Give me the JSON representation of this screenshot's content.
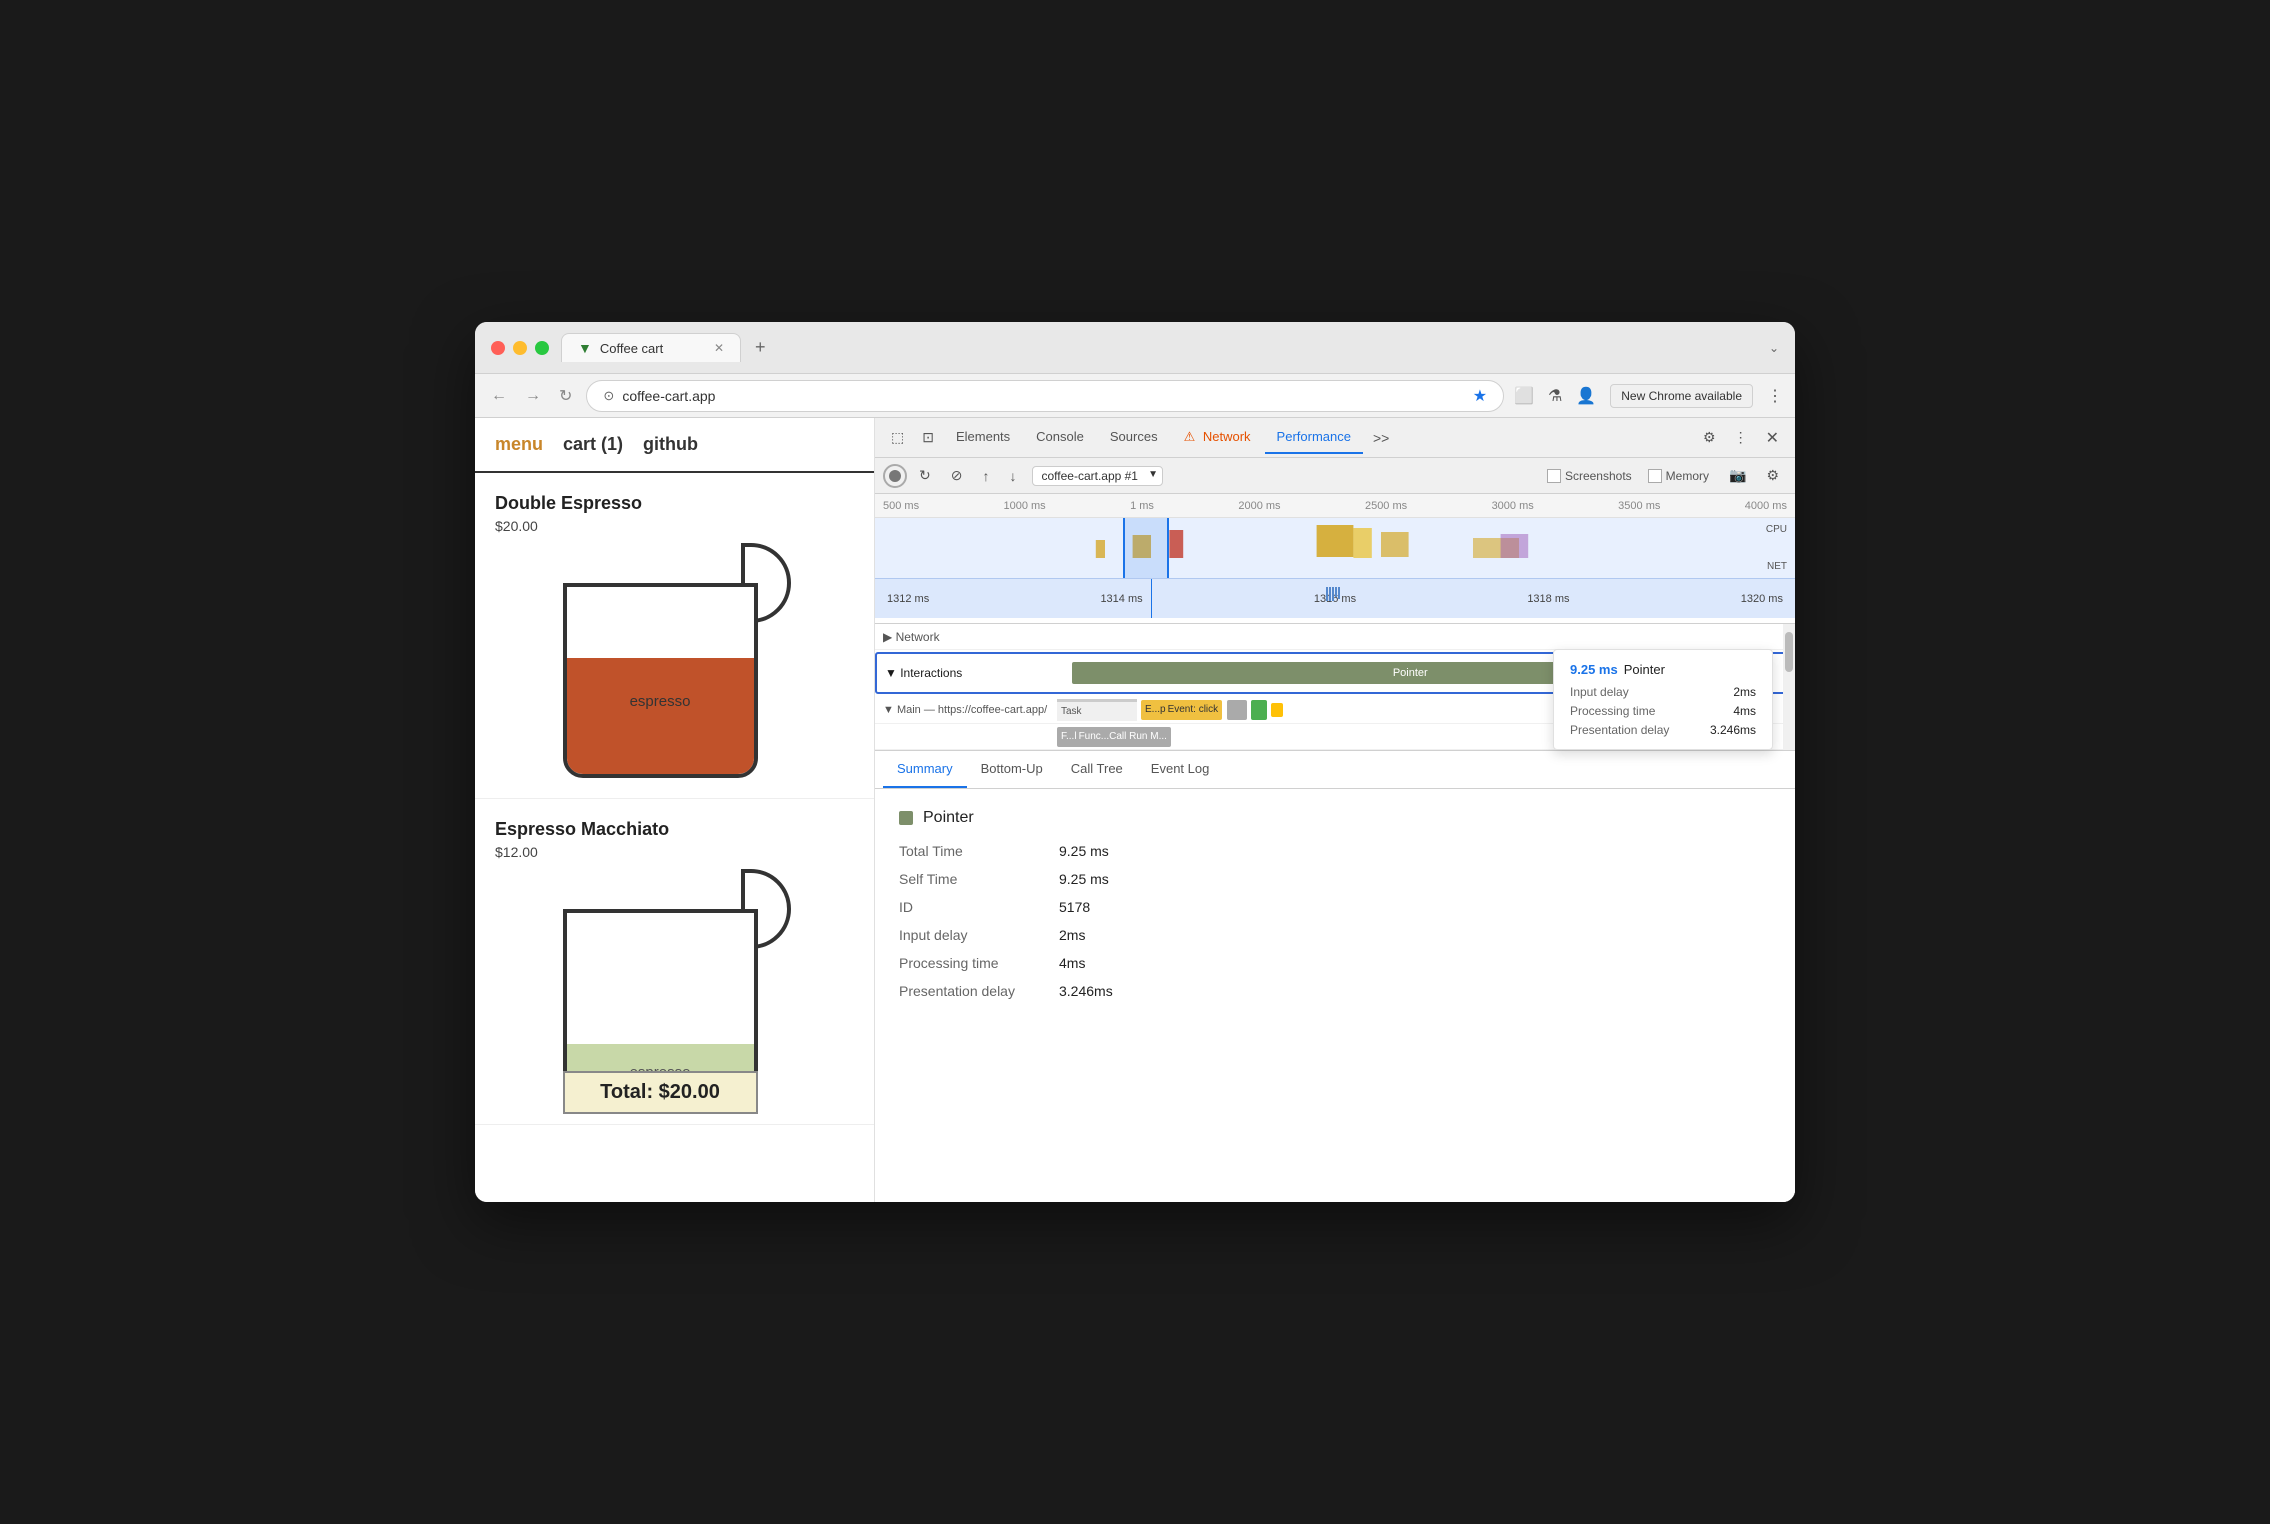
{
  "window": {
    "title": "Coffee cart"
  },
  "browser": {
    "url": "coffee-cart.app",
    "tab_title": "Coffee cart",
    "new_chrome_label": "New Chrome available"
  },
  "website": {
    "nav": {
      "menu": "menu",
      "cart": "cart (1)",
      "github": "github"
    },
    "products": [
      {
        "name": "Double Espresso",
        "price": "$20.00",
        "liquid_label": "espresso",
        "show_total": false
      },
      {
        "name": "Espresso Macchiato",
        "price": "$12.00",
        "liquid_label": "espresso",
        "show_total": true,
        "total": "Total: $20.00"
      }
    ]
  },
  "devtools": {
    "tabs": [
      "Elements",
      "Console",
      "Sources",
      "Network",
      "Performance"
    ],
    "active_tab": "Performance",
    "warning_tab": "Network",
    "target": "coffee-cart.app #1",
    "screenshots_label": "Screenshots",
    "memory_label": "Memory",
    "toolbar_buttons": [
      "record",
      "reload",
      "clear",
      "upload",
      "download"
    ],
    "timeline": {
      "ruler_marks": [
        "500 ms",
        "1000 ms",
        "1 ms",
        "2000 ms",
        "2500 ms",
        "3000 ms",
        "3500 ms",
        "4000 ms"
      ],
      "zoom_marks": [
        "1312 ms",
        "1314 ms",
        "1316 ms",
        "1318 ms",
        "1320 ms"
      ],
      "cpu_label": "CPU",
      "net_label": "NET"
    },
    "tracks": {
      "network_label": "▶ Network",
      "interactions_label": "▼ Interactions",
      "main_label": "▼ Main — https://coffee-cart.app/",
      "task_label": "Task",
      "event_label": "E...p",
      "event_text": "Event: click",
      "func_label": "F...l",
      "func_text": "Func...Call Run M..."
    },
    "tooltip": {
      "ms": "9.25 ms",
      "title": "Pointer",
      "input_delay_label": "Input delay",
      "input_delay_val": "2ms",
      "processing_time_label": "Processing time",
      "processing_time_val": "4ms",
      "presentation_delay_label": "Presentation delay",
      "presentation_delay_val": "3.246ms"
    },
    "summary": {
      "tabs": [
        "Summary",
        "Bottom-Up",
        "Call Tree",
        "Event Log"
      ],
      "active_tab": "Summary",
      "pointer_label": "Pointer",
      "rows": [
        {
          "key": "Total Time",
          "value": "9.25 ms"
        },
        {
          "key": "Self Time",
          "value": "9.25 ms"
        },
        {
          "key": "ID",
          "value": "5178"
        },
        {
          "key": "Input delay",
          "value": "2ms"
        },
        {
          "key": "Processing time",
          "value": "4ms"
        },
        {
          "key": "Presentation delay",
          "value": "3.246ms"
        }
      ]
    }
  }
}
